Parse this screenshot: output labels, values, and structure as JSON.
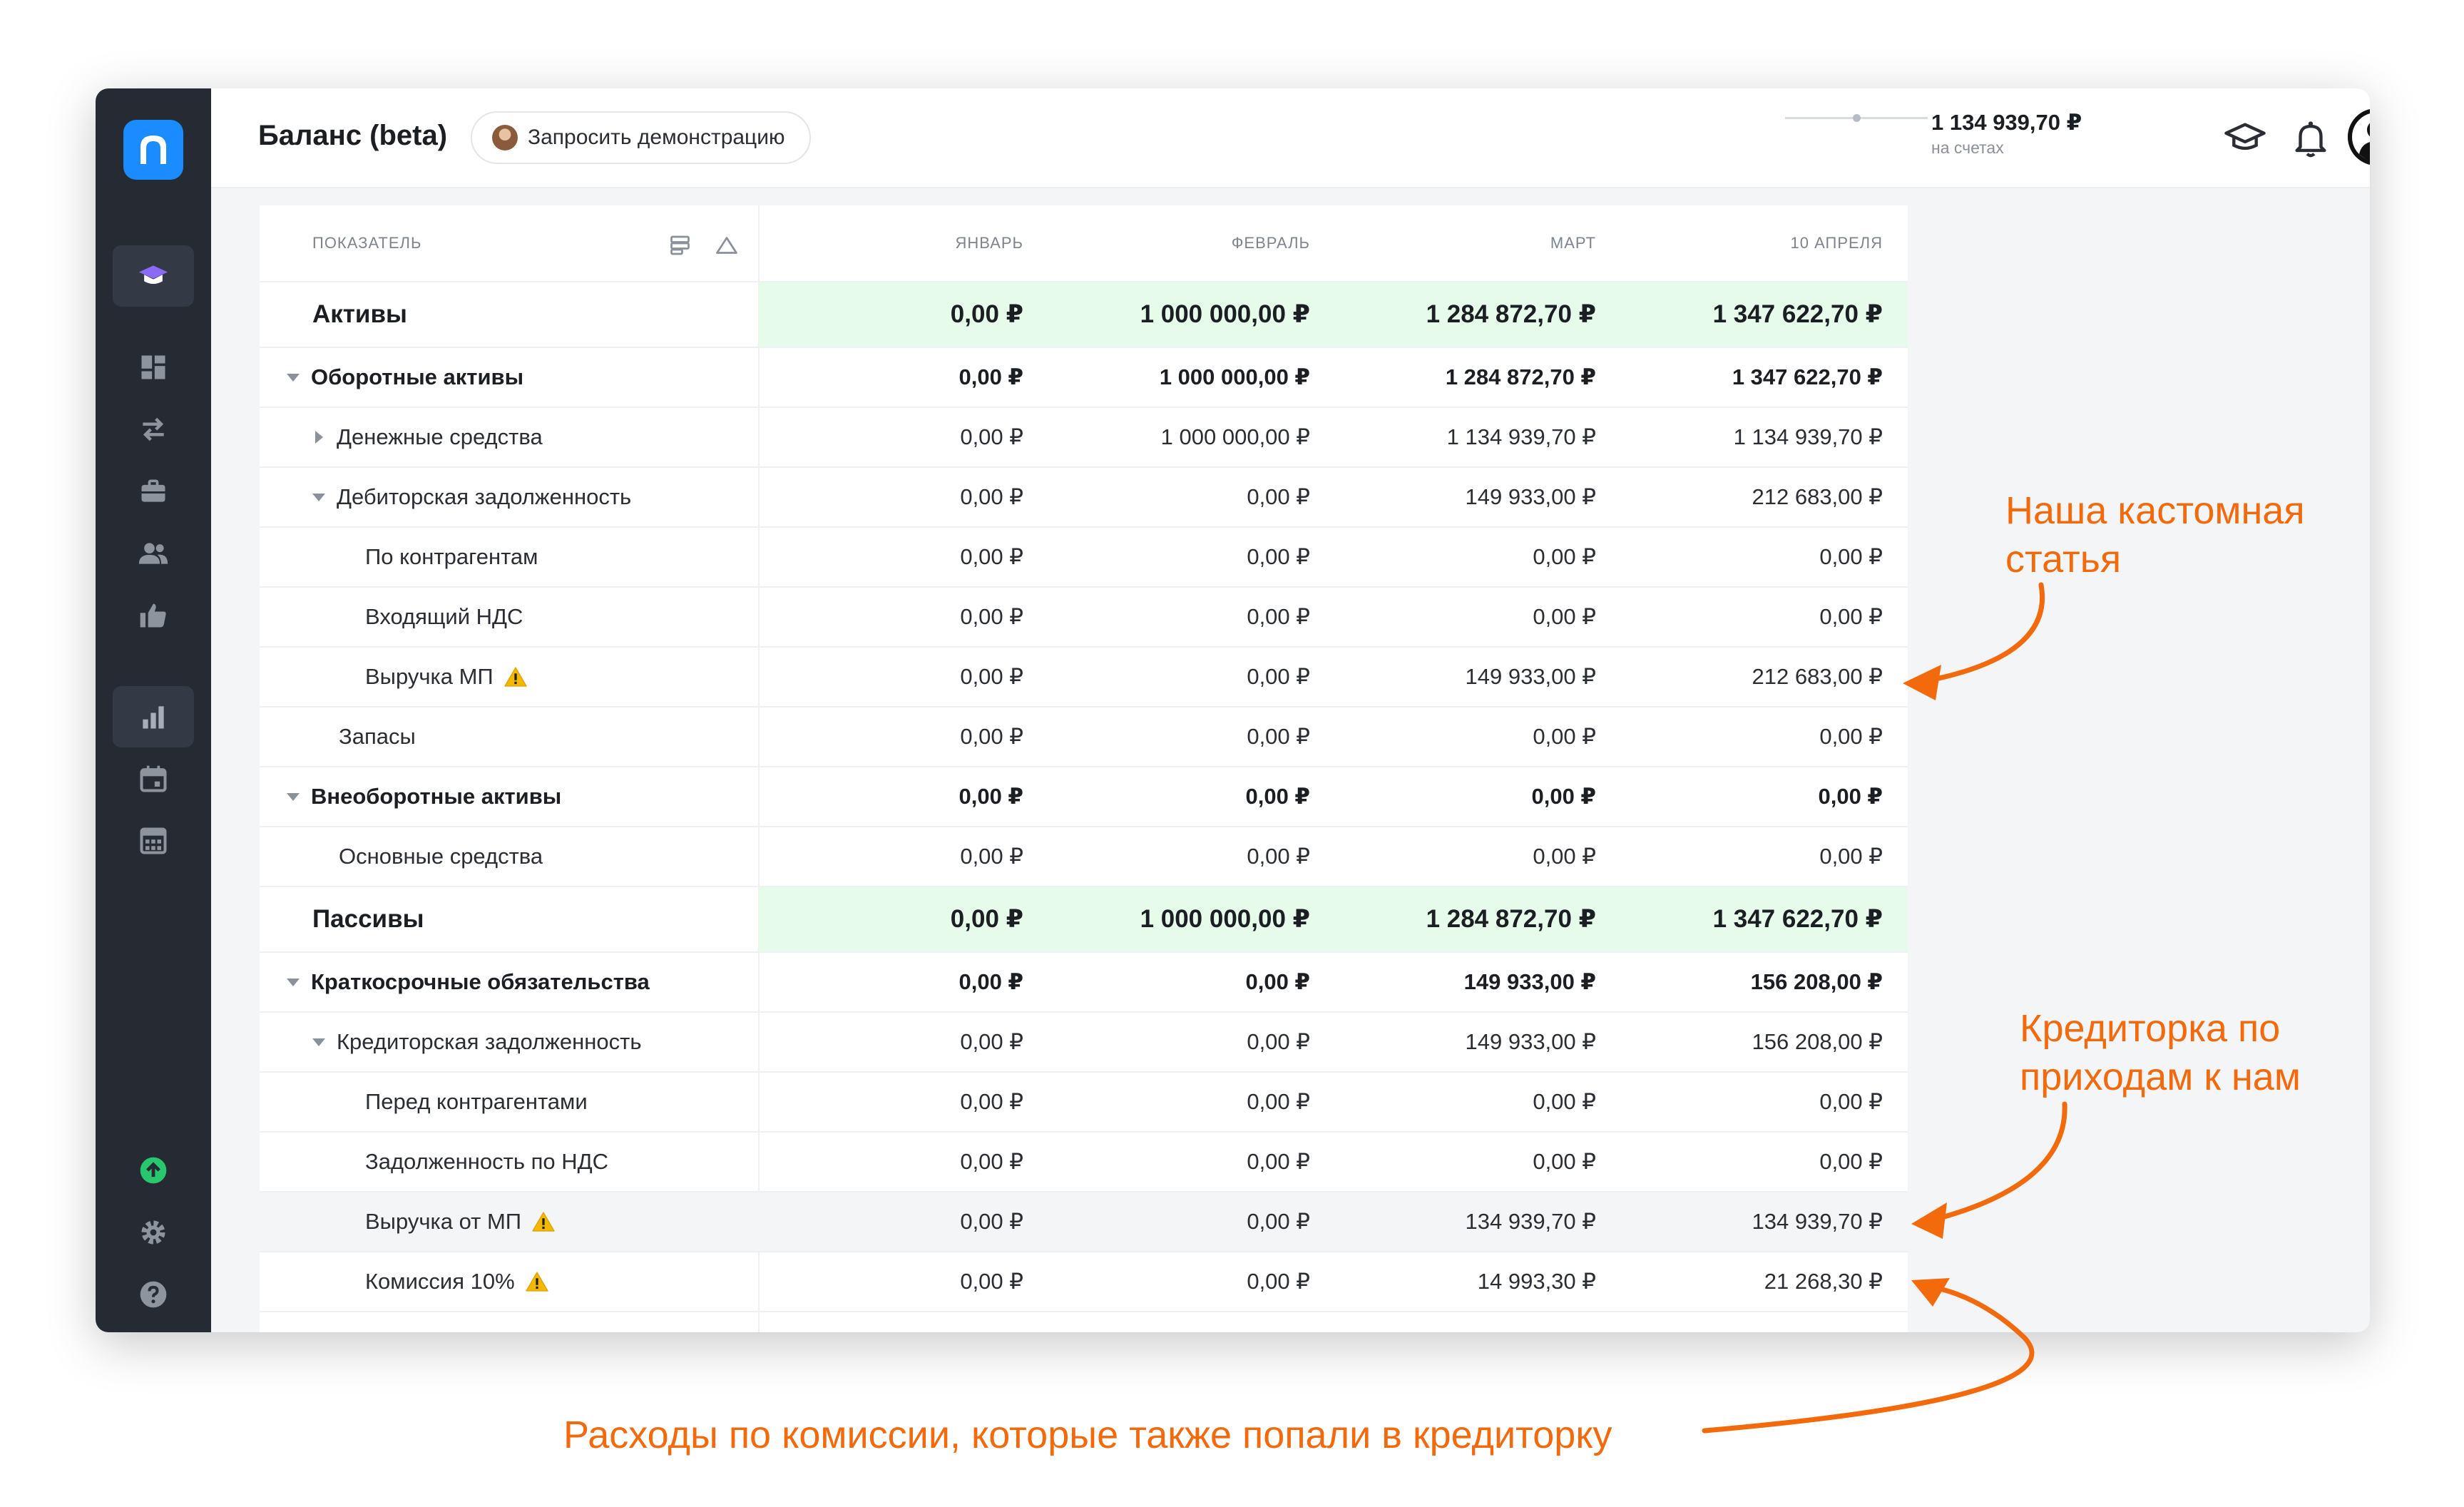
{
  "header": {
    "title": "Баланс (beta)",
    "demo_button": "Запросить демонстрацию",
    "balance": {
      "value": "1 134 939,70 ₽",
      "caption": "на счетах"
    }
  },
  "sidebar": {
    "icons": [
      "graduation-cap-icon",
      "dashboard-icon",
      "transfer-icon",
      "briefcase-icon",
      "users-icon",
      "thumbs-up-icon",
      "bar-chart-icon",
      "calendar-icon",
      "calculator-icon",
      "upload-icon",
      "gear-icon",
      "help-icon"
    ],
    "active": "bar-chart-icon"
  },
  "table": {
    "columns": [
      "ПОКАЗАТЕЛЬ",
      "ЯНВАРЬ",
      "ФЕВРАЛЬ",
      "МАРТ",
      "10 АПРЕЛЯ"
    ],
    "rows": [
      {
        "label": "Активы",
        "values": [
          "0,00 ₽",
          "1 000 000,00 ₽",
          "1 284 872,70 ₽",
          "1 347 622,70 ₽"
        ]
      },
      {
        "label": "Оборотные активы",
        "values": [
          "0,00 ₽",
          "1 000 000,00 ₽",
          "1 284 872,70 ₽",
          "1 347 622,70 ₽"
        ]
      },
      {
        "label": "Денежные средства",
        "values": [
          "0,00 ₽",
          "1 000 000,00 ₽",
          "1 134 939,70 ₽",
          "1 134 939,70 ₽"
        ]
      },
      {
        "label": "Дебиторская задолженность",
        "values": [
          "0,00 ₽",
          "0,00 ₽",
          "149 933,00 ₽",
          "212 683,00 ₽"
        ]
      },
      {
        "label": "По контрагентам",
        "values": [
          "0,00 ₽",
          "0,00 ₽",
          "0,00 ₽",
          "0,00 ₽"
        ]
      },
      {
        "label": "Входящий НДС",
        "values": [
          "0,00 ₽",
          "0,00 ₽",
          "0,00 ₽",
          "0,00 ₽"
        ]
      },
      {
        "label": "Выручка МП",
        "values": [
          "0,00 ₽",
          "0,00 ₽",
          "149 933,00 ₽",
          "212 683,00 ₽"
        ]
      },
      {
        "label": "Запасы",
        "values": [
          "0,00 ₽",
          "0,00 ₽",
          "0,00 ₽",
          "0,00 ₽"
        ]
      },
      {
        "label": "Внеоборотные активы",
        "values": [
          "0,00 ₽",
          "0,00 ₽",
          "0,00 ₽",
          "0,00 ₽"
        ]
      },
      {
        "label": "Основные средства",
        "values": [
          "0,00 ₽",
          "0,00 ₽",
          "0,00 ₽",
          "0,00 ₽"
        ]
      },
      {
        "label": "Пассивы",
        "values": [
          "0,00 ₽",
          "1 000 000,00 ₽",
          "1 284 872,70 ₽",
          "1 347 622,70 ₽"
        ]
      },
      {
        "label": "Краткосрочные обязательства",
        "values": [
          "0,00 ₽",
          "0,00 ₽",
          "149 933,00 ₽",
          "156 208,00 ₽"
        ]
      },
      {
        "label": "Кредиторская задолженность",
        "values": [
          "0,00 ₽",
          "0,00 ₽",
          "149 933,00 ₽",
          "156 208,00 ₽"
        ]
      },
      {
        "label": "Перед контрагентами",
        "values": [
          "0,00 ₽",
          "0,00 ₽",
          "0,00 ₽",
          "0,00 ₽"
        ]
      },
      {
        "label": "Задолженность по НДС",
        "values": [
          "0,00 ₽",
          "0,00 ₽",
          "0,00 ₽",
          "0,00 ₽"
        ]
      },
      {
        "label": "Выручка от МП",
        "values": [
          "0,00 ₽",
          "0,00 ₽",
          "134 939,70 ₽",
          "134 939,70 ₽"
        ]
      },
      {
        "label": "Комиссия 10%",
        "values": [
          "0,00 ₽",
          "0,00 ₽",
          "14 993,30 ₽",
          "21 268,30 ₽"
        ]
      }
    ]
  },
  "annotations": {
    "custom_item": [
      "Наша кастомная",
      "статья"
    ],
    "creditor": [
      "Кредиторка по",
      "приходам к нам"
    ],
    "commission": "Расходы по комиссии, которые также попали в кредиторку"
  },
  "colors": {
    "accent": "#1a8cff",
    "annotation": "#f26a0c",
    "total_highlight": "#e6fbe9",
    "sidebar": "#252a33"
  }
}
